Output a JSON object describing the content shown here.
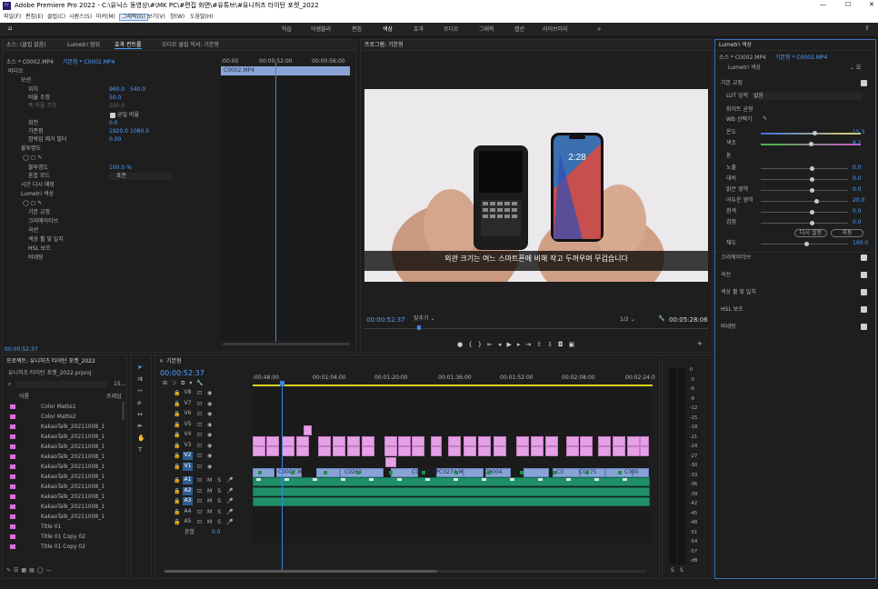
{
  "app": {
    "title": "Adobe Premiere Pro 2022 - C:\\유닉스 동영상\\#\\MK PC\\#편집 화면\\#유튜브\\#유니허츠 타이탄 포켓_2022",
    "menu": [
      "파일(F)",
      "편집(E)",
      "클립(C)",
      "시퀀스(S)",
      "마커(M)",
      "그래픽(G)",
      "보기(V)",
      "창(W)",
      "도움말(H)"
    ],
    "workspaces": [
      "학습",
      "어셈블리",
      "편집",
      "색상",
      "효과",
      "오디오",
      "그래픽",
      "캡션",
      "라이브러리"
    ],
    "active_workspace": "색상"
  },
  "source_panel": {
    "tabs": [
      "소스: (클립 없음)",
      "Lumetri 범위",
      "효과 컨트롤",
      "오디오 클립 믹서: 기본형"
    ],
    "active_tab": "효과 컨트롤",
    "source_label": "소스 * C0002.MP4",
    "sequence_label": "기본형 * C0002.MP4",
    "ruler": [
      ":00:00",
      "00:00:52:00",
      "00:00:56:00"
    ],
    "clip_name": "C0002.MP4",
    "section_video": "비디오",
    "fx_motion": "모션",
    "position_label": "위치",
    "position_x": "960.0",
    "position_y": "540.0",
    "scale_label": "비율 조정",
    "scale_value": "50.0",
    "scale_width_label": "폭 비율 조정",
    "scale_width_value": "100.0",
    "uniform_scale_label": "균일 비율",
    "rotation_label": "회전",
    "rotation_value": "0.0",
    "anchor_label": "기준점",
    "anchor_x": "1920.0",
    "anchor_y": "1080.0",
    "antiflicker_label": "깜박임 제거 필터",
    "antiflicker_value": "0.00",
    "fx_opacity": "불투명도",
    "opacity_label": "불투명도",
    "opacity_value": "100.0 %",
    "blend_label": "혼합 모드",
    "blend_value": "표준",
    "time_remap": "시간 다시 매핑",
    "fx_lumetri": "Lumetri 색상",
    "lumetri_items": [
      "기본 교정",
      "크리에이티브",
      "곡선",
      "색상 휠 및 일치",
      "HSL 보조",
      "비네팅"
    ],
    "timecode": "00:00:52:37"
  },
  "program_panel": {
    "title": "프로그램: 기본형",
    "subtitle": "외관 크기는 여느 스마트폰에 비해 작고 두꺼우며 무겁습니다",
    "timecode": "00:00:52:37",
    "fit": "맞추기",
    "resolution": "1/2",
    "duration": "00:05:28:06"
  },
  "lumetri_panel": {
    "title": "Lumetri 색상",
    "source_label": "소스 * C0002.MP4",
    "sequence_label": "기본형 * C0002.MP4",
    "fx_label": "Lumetri 색상",
    "basic_correction": "기본 교정",
    "lut_label": "LUT 입력",
    "lut_value": "없음",
    "white_balance": "화이트 균형",
    "wb_selector": "WB 선택기",
    "temp_label": "온도",
    "temp_value": "15.3",
    "tint_label": "색조",
    "tint_value": "8.2",
    "tone": "톤",
    "tone_sliders": [
      {
        "label": "노출",
        "value": "0.0"
      },
      {
        "label": "대비",
        "value": "0.0"
      },
      {
        "label": "밝은 영역",
        "value": "0.0"
      },
      {
        "label": "어두운 영역",
        "value": "20.0"
      },
      {
        "label": "흰색",
        "value": "0.0"
      },
      {
        "label": "검정",
        "value": "0.0"
      }
    ],
    "reset_button": "다시 설정",
    "auto_button": "자동",
    "saturation_label": "채도",
    "saturation_value": "100.0",
    "sections": [
      "크리에이티브",
      "곡선",
      "색상 휠 및 일치",
      "HSL 보조",
      "비네팅"
    ]
  },
  "project_panel": {
    "title": "프로젝트: 유니허츠 타이탄 포켓_2022",
    "file": "유니허츠 타이탄 포켓_2022.prproj",
    "count": "15...",
    "col_name": "이름",
    "col_rate": "프레임",
    "items": [
      "Color Matte1",
      "Color Matte2",
      "KakaoTalk_20211008_1",
      "KakaoTalk_20211008_1",
      "KakaoTalk_20211008_1",
      "KakaoTalk_20211008_1",
      "KakaoTalk_20211008_1",
      "KakaoTalk_20211008_1",
      "KakaoTalk_20211008_1",
      "KakaoTalk_20211008_1",
      "KakaoTalk_20211008_1",
      "KakaoTalk_20211008_1",
      "Title 01",
      "Title 01 Copy 02",
      "Title 01 Copy 02"
    ]
  },
  "timeline": {
    "title": "기본형",
    "timecode": "00:00:52:37",
    "ruler": [
      ":00:48:00",
      "00:01:04:00",
      "00:01:20:00",
      "00:01:36:00",
      "00:01:52:00",
      "00:02:08:00",
      "00:02:24:0"
    ],
    "video_tracks": [
      "V8",
      "V7",
      "V6",
      "V5",
      "V4",
      "V3",
      "V2",
      "V1"
    ],
    "audio_tracks": [
      "A1",
      "A2",
      "A3",
      "A4",
      "A5"
    ],
    "mix_label": "혼합",
    "mix_value": "0.0",
    "v1_clips": [
      "C0002.M",
      "C0262",
      "C0003.MP",
      "C0274.M",
      "C0004.",
      "C0",
      "C0275",
      "C000"
    ]
  },
  "meter": {
    "scale": [
      "0",
      "-3",
      "-6",
      "-9",
      "-12",
      "-15",
      "-18",
      "-21",
      "-24",
      "-27",
      "-30",
      "-33",
      "-36",
      "-39",
      "-42",
      "-45",
      "-48",
      "-51",
      "-54",
      "-57",
      "-dB"
    ],
    "bottom": [
      "S",
      "S"
    ]
  },
  "colors": {
    "accent": "#4ea1ff",
    "clip_pink": "#e5a1e5",
    "clip_blue": "#8aa3d6",
    "clip_audio": "#1f8f6a",
    "playhead": "#3b86e0"
  }
}
